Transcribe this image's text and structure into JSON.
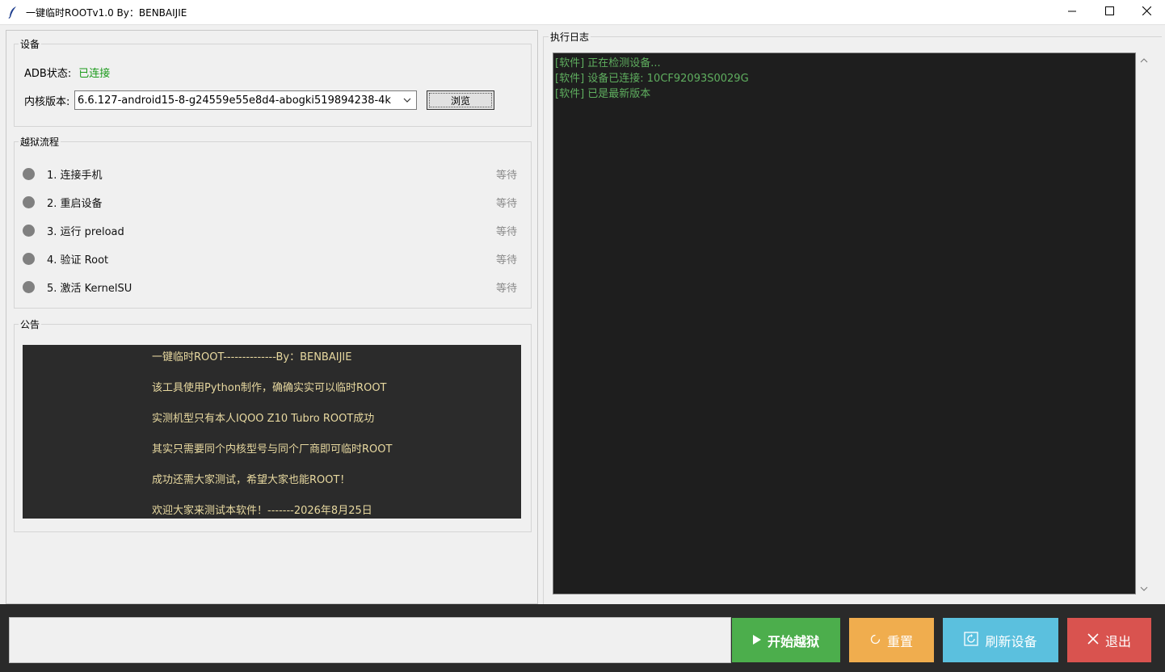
{
  "window": {
    "title": "一键临时ROOTv1.0 By：BENBAIJIE"
  },
  "device_group": {
    "legend": "设备",
    "adb_label": "ADB状态:",
    "adb_status": "已连接",
    "adb_status_color": "#1a9a1a",
    "kernel_label": "内核版本:",
    "kernel_value": "6.6.127-android15-8-g24559e55e8d4-abogki519894238-4k",
    "browse_label": "浏览"
  },
  "flow_group": {
    "legend": "越狱流程",
    "steps": [
      {
        "label": "1. 连接手机",
        "status": "等待"
      },
      {
        "label": "2. 重启设备",
        "status": "等待"
      },
      {
        "label": "3. 运行 preload",
        "status": "等待"
      },
      {
        "label": "4. 验证 Root",
        "status": "等待"
      },
      {
        "label": "5. 激活 KernelSU",
        "status": "等待"
      }
    ]
  },
  "notice_group": {
    "legend": "公告",
    "lines": [
      "一键临时ROOT--------------By：BENBAIJIE",
      "该工具使用Python制作，确确实实可以临时ROOT",
      "实测机型只有本人IQOO Z10 Tubro ROOT成功",
      "其实只需要同个内核型号与同个厂商即可临时ROOT",
      "成功还需大家测试，希望大家也能ROOT！",
      "欢迎大家来测试本软件！-------2026年8月25日"
    ]
  },
  "log_group": {
    "legend": "执行日志",
    "lines": [
      "[软件] 正在检测设备...",
      "[软件] 设备已连接: 10CF92093S0029G",
      "[软件] 已是最新版本"
    ]
  },
  "actions": {
    "start": "开始越狱",
    "reset": "重置",
    "refresh": "刷新设备",
    "exit": "退出"
  },
  "colors": {
    "start": "#4cae4c",
    "reset": "#f0ad4e",
    "refresh": "#5bc0de",
    "exit": "#d9534f",
    "log_text": "#5fae5f",
    "notice_text": "#e8d9a0"
  }
}
